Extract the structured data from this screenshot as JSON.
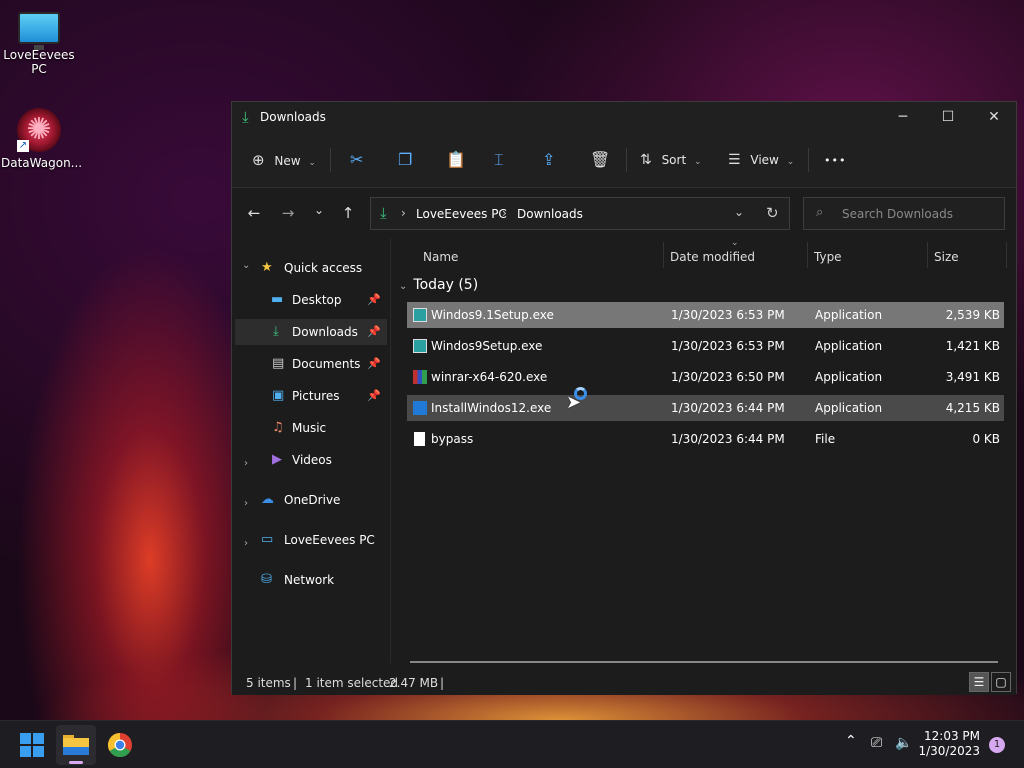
{
  "desktop": {
    "icons": [
      {
        "label": "LoveEevees PC",
        "icon": "computer-icon"
      },
      {
        "label": "DataWagon...",
        "icon": "datawagon-icon"
      }
    ]
  },
  "window": {
    "title": "Downloads",
    "controls": {
      "minimize": "─",
      "maximize": "☐",
      "close": "✕"
    }
  },
  "toolbar": {
    "new_label": "New",
    "sort_label": "Sort",
    "view_label": "View",
    "more_label": "•••"
  },
  "navigation": {
    "back": "←",
    "forward": "→",
    "recent": "⌄",
    "up": "↑",
    "breadcrumb": [
      "LoveEevees PC",
      "Downloads"
    ],
    "refresh": "↻",
    "search_placeholder": "Search Downloads"
  },
  "sidebar": {
    "quick_access": "Quick access",
    "items": [
      {
        "label": "Desktop",
        "icon": "desktop-icon",
        "pinned": true
      },
      {
        "label": "Downloads",
        "icon": "download-icon",
        "pinned": true,
        "selected": true
      },
      {
        "label": "Documents",
        "icon": "documents-icon",
        "pinned": true
      },
      {
        "label": "Pictures",
        "icon": "pictures-icon",
        "pinned": true
      },
      {
        "label": "Music",
        "icon": "music-icon",
        "pinned": false
      },
      {
        "label": "Videos",
        "icon": "videos-icon",
        "pinned": false
      }
    ],
    "onedrive": "OneDrive",
    "this_pc": "LoveEevees PC",
    "network": "Network"
  },
  "file_list": {
    "columns": [
      "Name",
      "Date modified",
      "Type",
      "Size"
    ],
    "group": "Today (5)",
    "rows": [
      {
        "name": "Windos9.1Setup.exe",
        "date": "1/30/2023 6:53 PM",
        "type": "Application",
        "size": "2,539 KB",
        "state": "selected"
      },
      {
        "name": "Windos9Setup.exe",
        "date": "1/30/2023 6:53 PM",
        "type": "Application",
        "size": "1,421 KB",
        "state": "normal"
      },
      {
        "name": "winrar-x64-620.exe",
        "date": "1/30/2023 6:50 PM",
        "type": "Application",
        "size": "3,491 KB",
        "state": "normal"
      },
      {
        "name": "InstallWindos12.exe",
        "date": "1/30/2023 6:44 PM",
        "type": "Application",
        "size": "4,215 KB",
        "state": "hover"
      },
      {
        "name": "bypass",
        "date": "1/30/2023 6:44 PM",
        "type": "File",
        "size": "0 KB",
        "state": "normal"
      }
    ]
  },
  "status": {
    "items": "5 items",
    "selected": "1 item selected",
    "size": "2.47 MB"
  },
  "taskbar": {
    "time": "12:03 PM",
    "date": "1/30/2023",
    "notifications": "1",
    "colors": {
      "accent": "#3a8ee8",
      "downloads_green": "#3cc47c"
    }
  }
}
